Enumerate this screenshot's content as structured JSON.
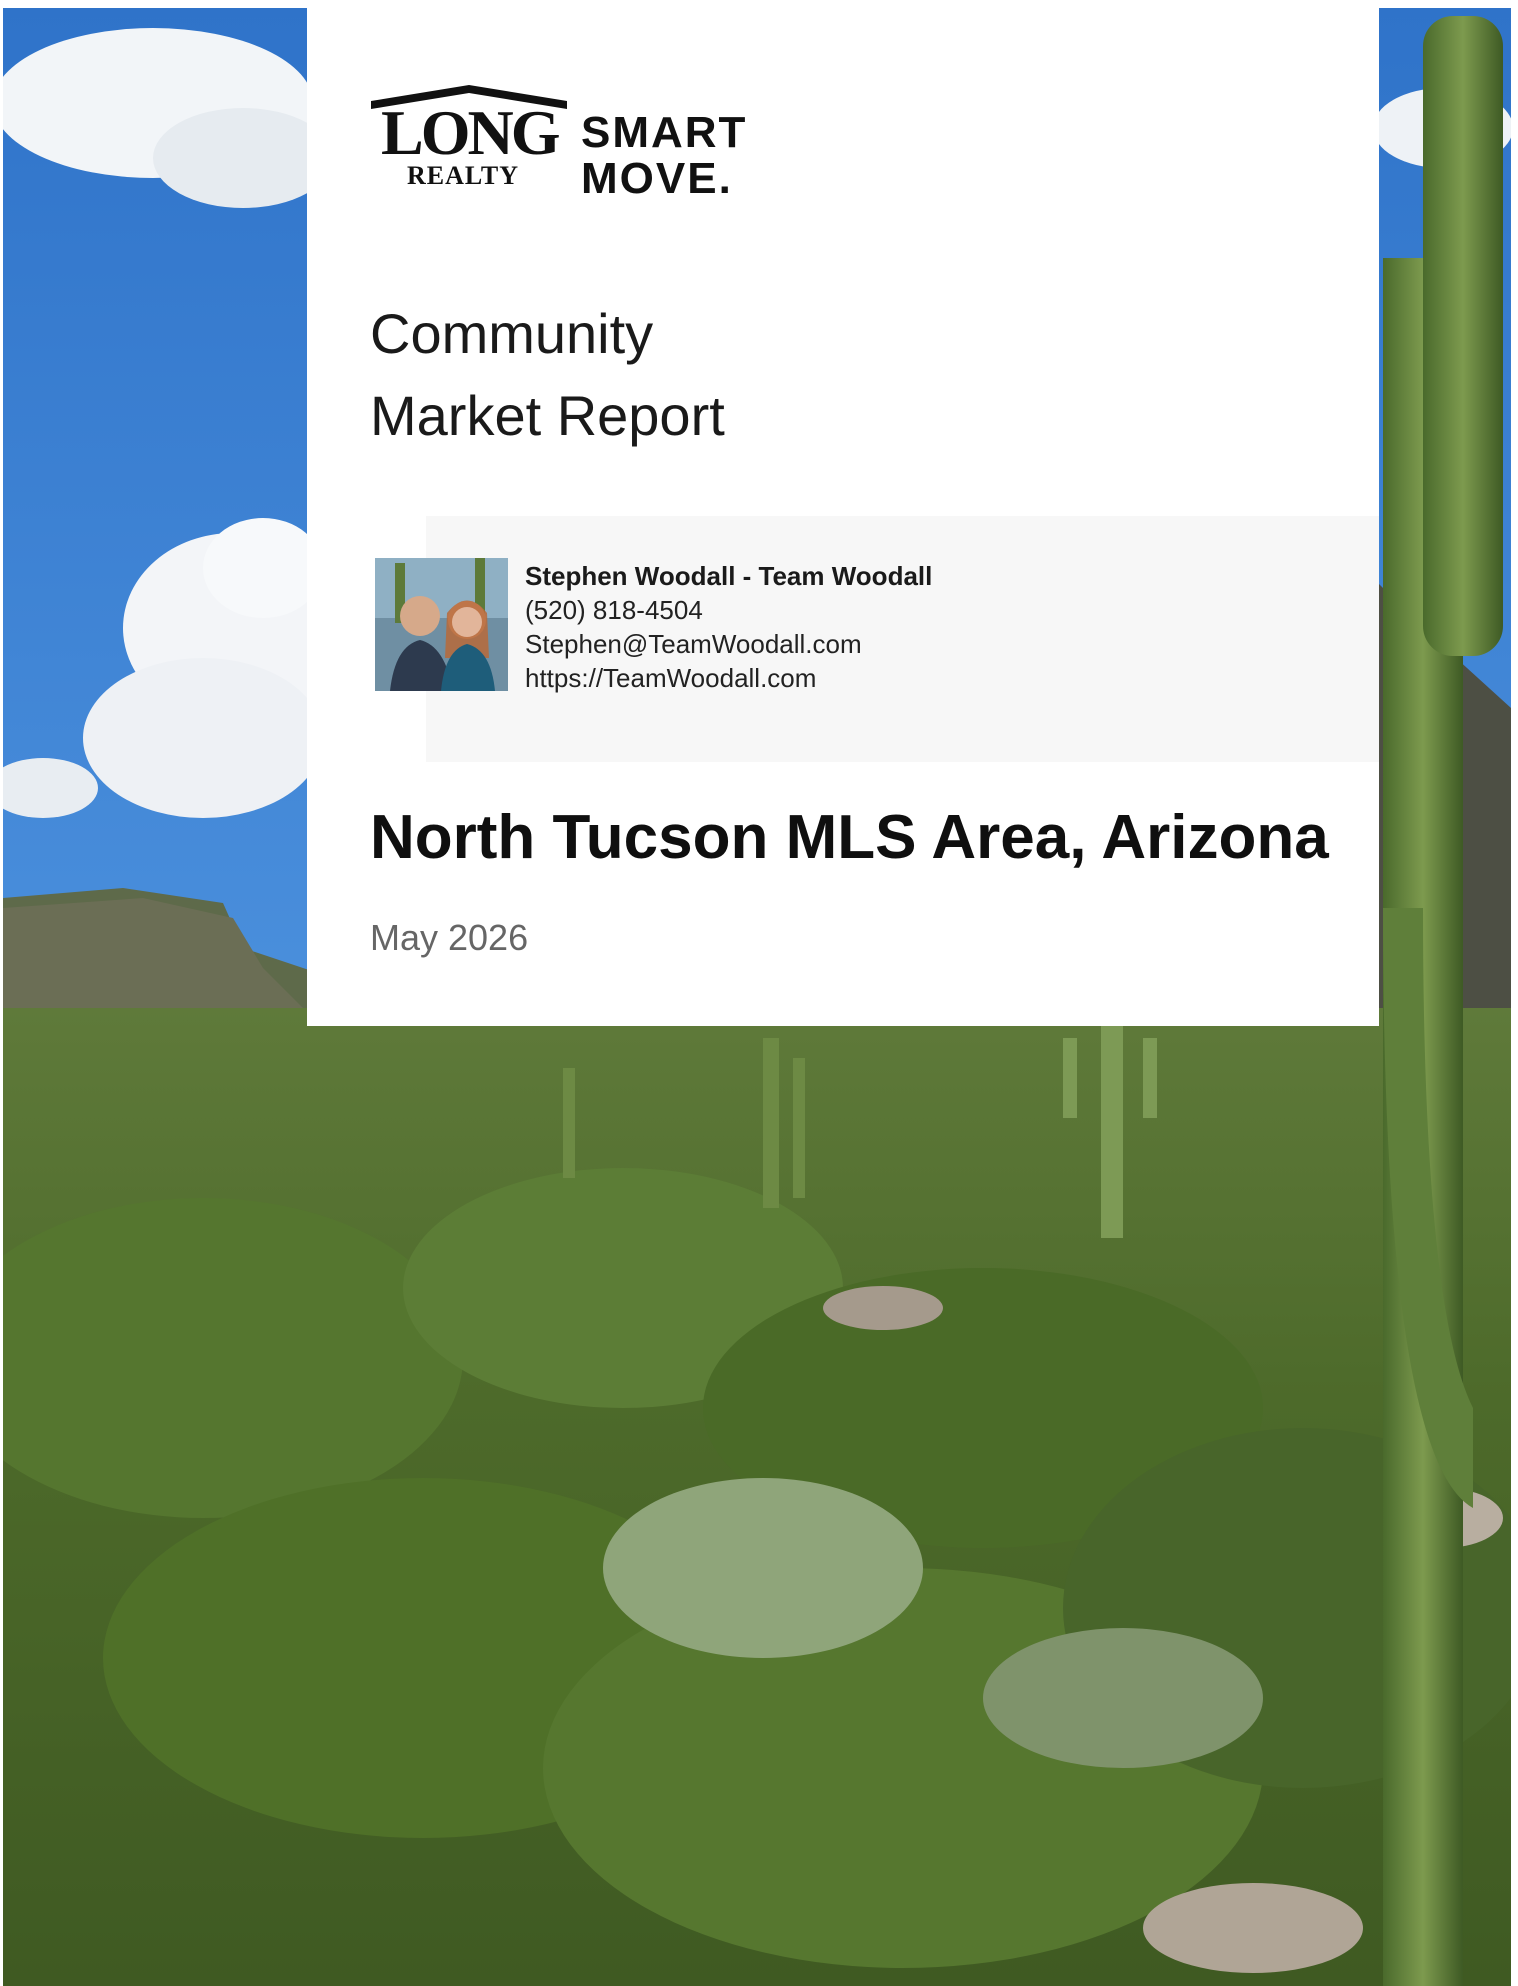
{
  "brand": {
    "logo_long": "LONG",
    "logo_realty": "REALTY",
    "logo_smart": "SMART",
    "logo_move": "MOVE."
  },
  "report": {
    "title_line1": "Community",
    "title_line2": "Market Report",
    "area": "North Tucson MLS Area, Arizona",
    "date": "May 2026"
  },
  "agent": {
    "name": "Stephen Woodall - Team Woodall",
    "phone": "(520) 818-4504",
    "email": "Stephen@TeamWoodall.com",
    "website": "https://TeamWoodall.com"
  },
  "colors": {
    "sky": "#3b7fd0",
    "vegetation": "#4f6b2e",
    "card": "#ffffff",
    "panel": "#f7f7f7",
    "date_text": "#666666"
  }
}
